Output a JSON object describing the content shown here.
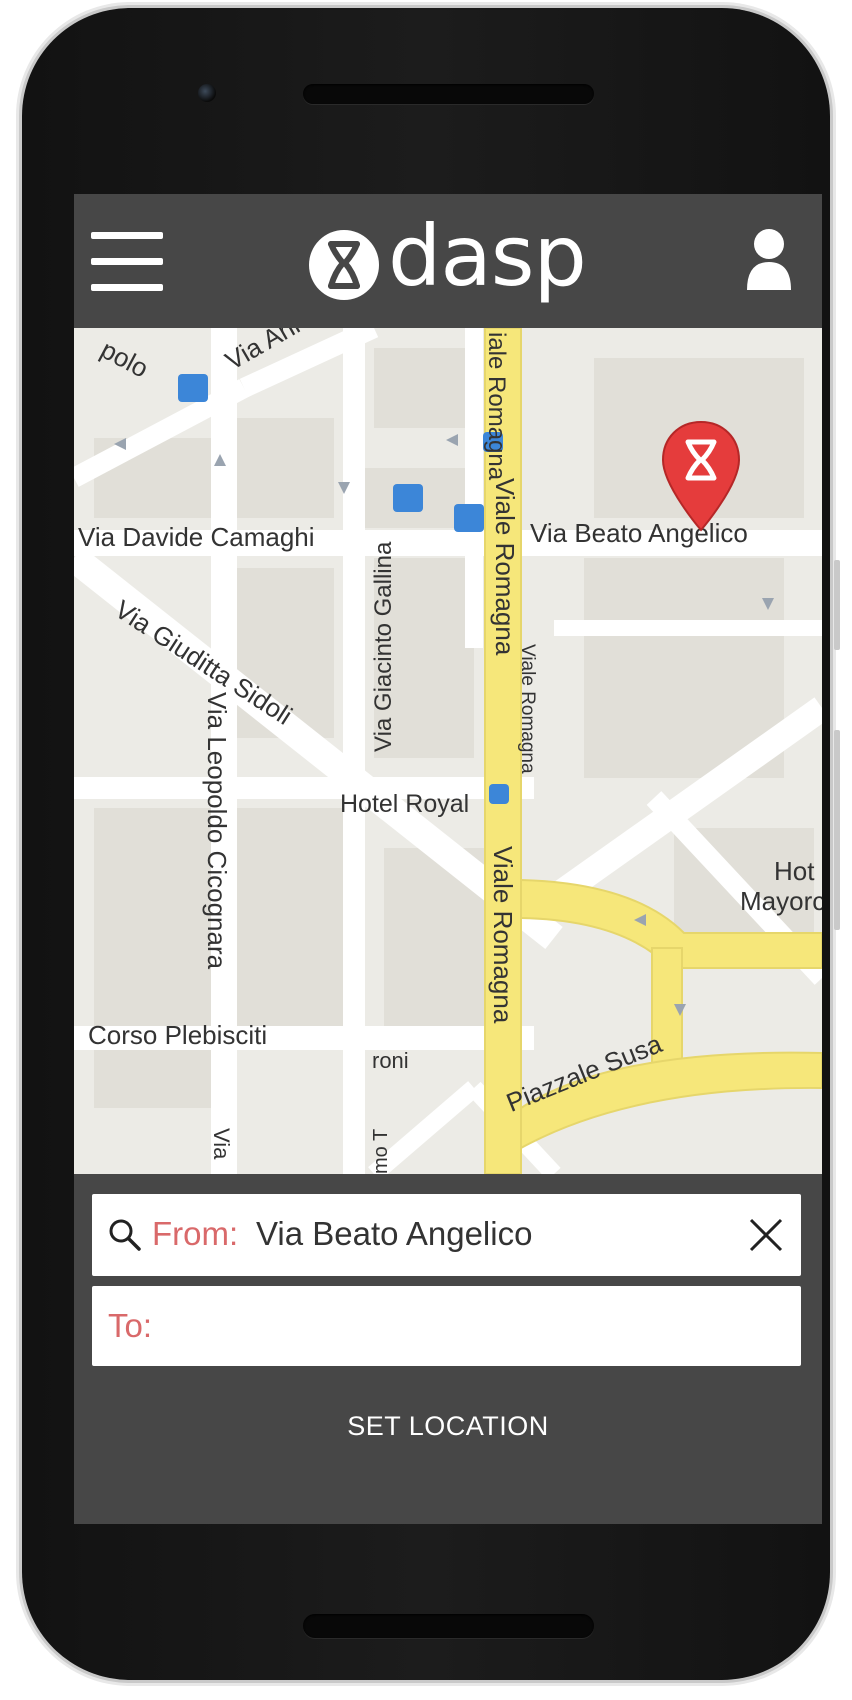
{
  "app": {
    "logo_text": "dasp"
  },
  "header": {
    "menu_icon": "hamburger-menu-icon",
    "logo_icon": "hourglass-logo-icon",
    "profile_icon": "user-profile-icon"
  },
  "map": {
    "streets": [
      "polo",
      "Via Ani",
      "iale Romagna",
      "Viale Romagna",
      "Via Beato Angelico",
      "Via Davide Camaghi",
      "Via Giacinto Gallina",
      "Via Giuditta Sidoli",
      "Via Leopoldo Cicognara",
      "Viale Romagna",
      "Viale Romagna",
      "Corso Plebisciti",
      "Piazzale Susa",
      "Via",
      "mo T",
      "roni"
    ],
    "places": [
      "Hotel Royal",
      "Hot",
      "Mayorc"
    ],
    "pin_icon": "location-pin-icon"
  },
  "form": {
    "from_label": "From:",
    "from_value": "Via Beato Angelico",
    "to_label": "To:",
    "to_value": "",
    "search_icon": "search-icon",
    "clear_icon": "close-icon"
  },
  "action": {
    "set_location_label": "SET LOCATION"
  },
  "colors": {
    "header_bg": "#474747",
    "accent_label": "#d9696a",
    "pin_red": "#e53c3c",
    "major_road": "#f6e77a"
  }
}
